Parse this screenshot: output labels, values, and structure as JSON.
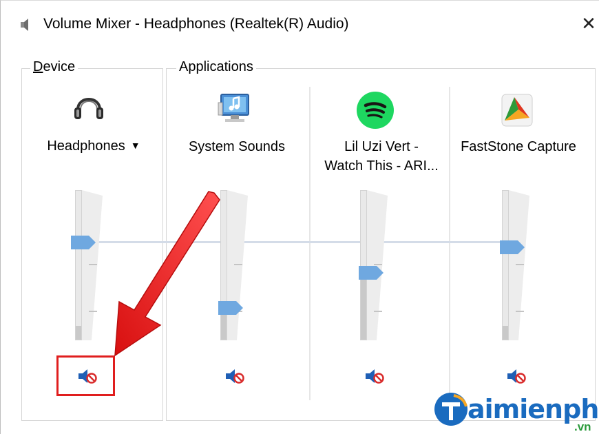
{
  "window": {
    "title": "Volume Mixer - Headphones (Realtek(R) Audio)",
    "close_glyph": "✕"
  },
  "device_group": {
    "label": "Device",
    "device_name": "Headphones",
    "dropdown_glyph": "▼",
    "icon": "headphones-icon",
    "volume": 0.6,
    "muted": false
  },
  "apps_group": {
    "label": "Applications",
    "apps": [
      {
        "name": "System Sounds",
        "icon": "system-sounds-icon",
        "volume": 0.19
      },
      {
        "name_line1": "Lil Uzi Vert -",
        "name_line2": "Watch This - ARI...",
        "icon": "spotify-icon",
        "volume": 0.4
      },
      {
        "name": "FastStone Capture",
        "icon": "faststone-capture-icon",
        "volume": 0.6
      }
    ]
  },
  "watermark": {
    "text": "aimienphi",
    "suffix": ".vn"
  },
  "colors": {
    "thumb": "#6fa8e0",
    "mute_speaker": "#1f5fb5",
    "mute_badge": "#d92c2c",
    "annotation": "#e01e1e",
    "spotify": "#1ed760",
    "watermark_blue": "#1a6bbf"
  }
}
